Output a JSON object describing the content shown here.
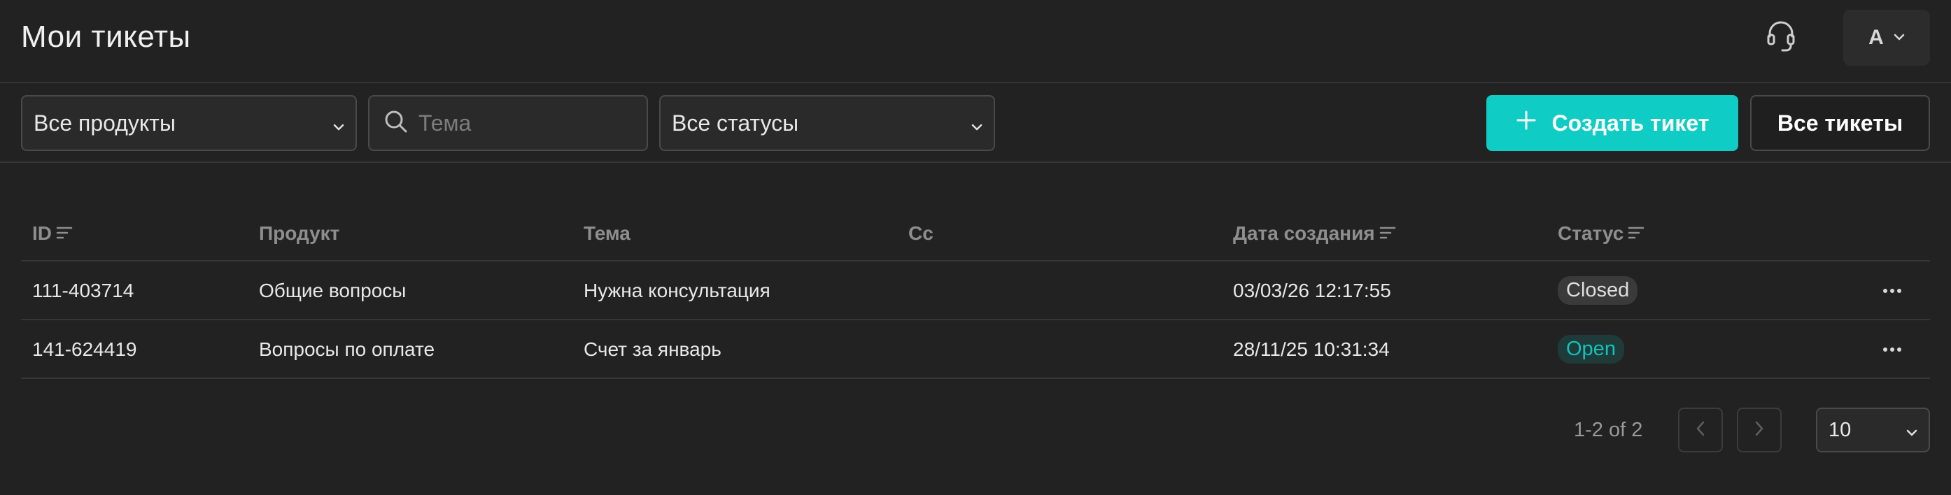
{
  "header": {
    "title": "Мои тикеты",
    "avatar_letter": "A"
  },
  "filters": {
    "product_select": "Все продукты",
    "search_placeholder": "Тема",
    "status_select": "Все статусы",
    "create_label": "Создать тикет",
    "all_label": "Все тикеты"
  },
  "table": {
    "columns": [
      "ID",
      "Продукт",
      "Тема",
      "Cc",
      "Дата создания",
      "Статус"
    ],
    "rows": [
      {
        "id": "111-403714",
        "product": "Общие вопросы",
        "subject": "Нужна консультация",
        "cc": "",
        "created": "03/03/26 12:17:55",
        "status": "Closed"
      },
      {
        "id": "141-624419",
        "product": "Вопросы по оплате",
        "subject": "Счет за январь",
        "cc": "",
        "created": "28/11/25 10:31:34",
        "status": "Open"
      }
    ]
  },
  "pagination": {
    "info": "1-2 of 2",
    "page_size": "10"
  },
  "colors": {
    "accent": "#0fcdc4",
    "background": "#222222",
    "open_status": "#13c2b8"
  }
}
